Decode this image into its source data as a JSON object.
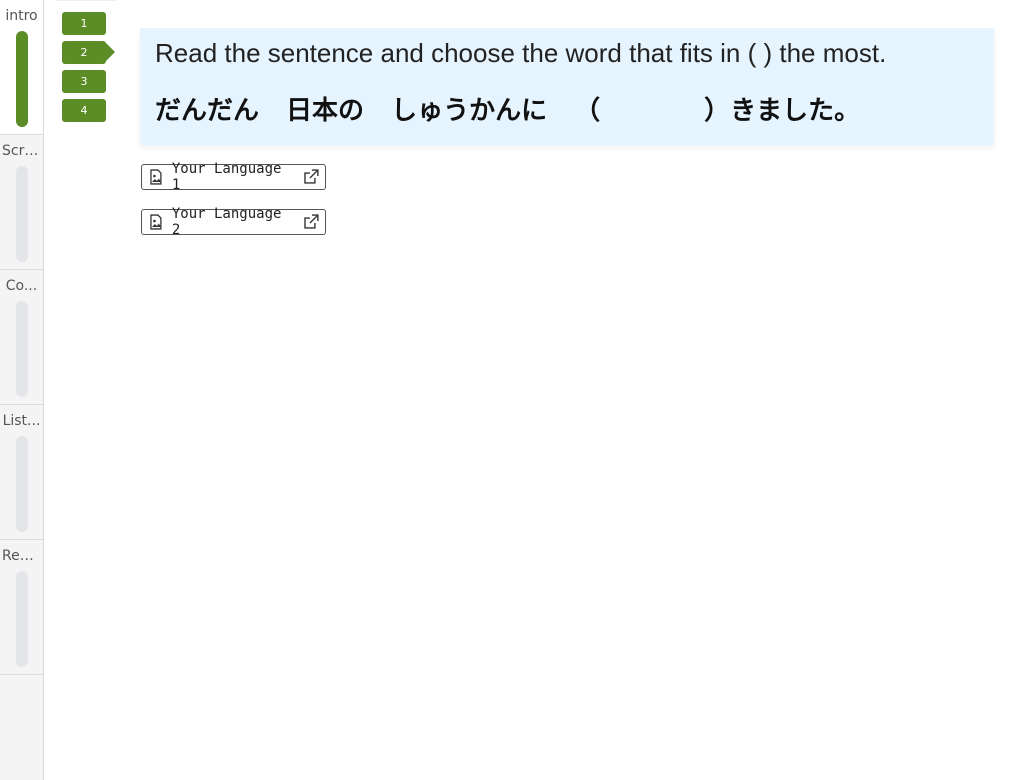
{
  "sidebar": {
    "sections": [
      {
        "label": "intro",
        "active": true,
        "progress": 1.0
      },
      {
        "label": "Scri...",
        "active": false,
        "progress": 0
      },
      {
        "label": "Co...",
        "active": false,
        "progress": 0
      },
      {
        "label": "List...",
        "active": false,
        "progress": 0
      },
      {
        "label": "Rea...",
        "active": false,
        "progress": 0
      }
    ]
  },
  "question_nav": {
    "items": [
      "1",
      "2",
      "3",
      "4"
    ],
    "current": "2"
  },
  "question": {
    "instruction": "Read the sentence and choose the word that fits in (    ) the most.",
    "sentence": "だんだん 日本の しゅうかんに （　　　　）きました。"
  },
  "language_buttons": [
    {
      "label": "Your Language 1",
      "icon": "image-icon",
      "ext_icon": "external-link-icon"
    },
    {
      "label": "Your Language 2",
      "icon": "image-icon",
      "ext_icon": "external-link-icon"
    }
  ],
  "colors": {
    "accent": "#5c8c26",
    "question_bg": "#e6f4ff",
    "sidebar_bg": "#f4f4f4"
  }
}
